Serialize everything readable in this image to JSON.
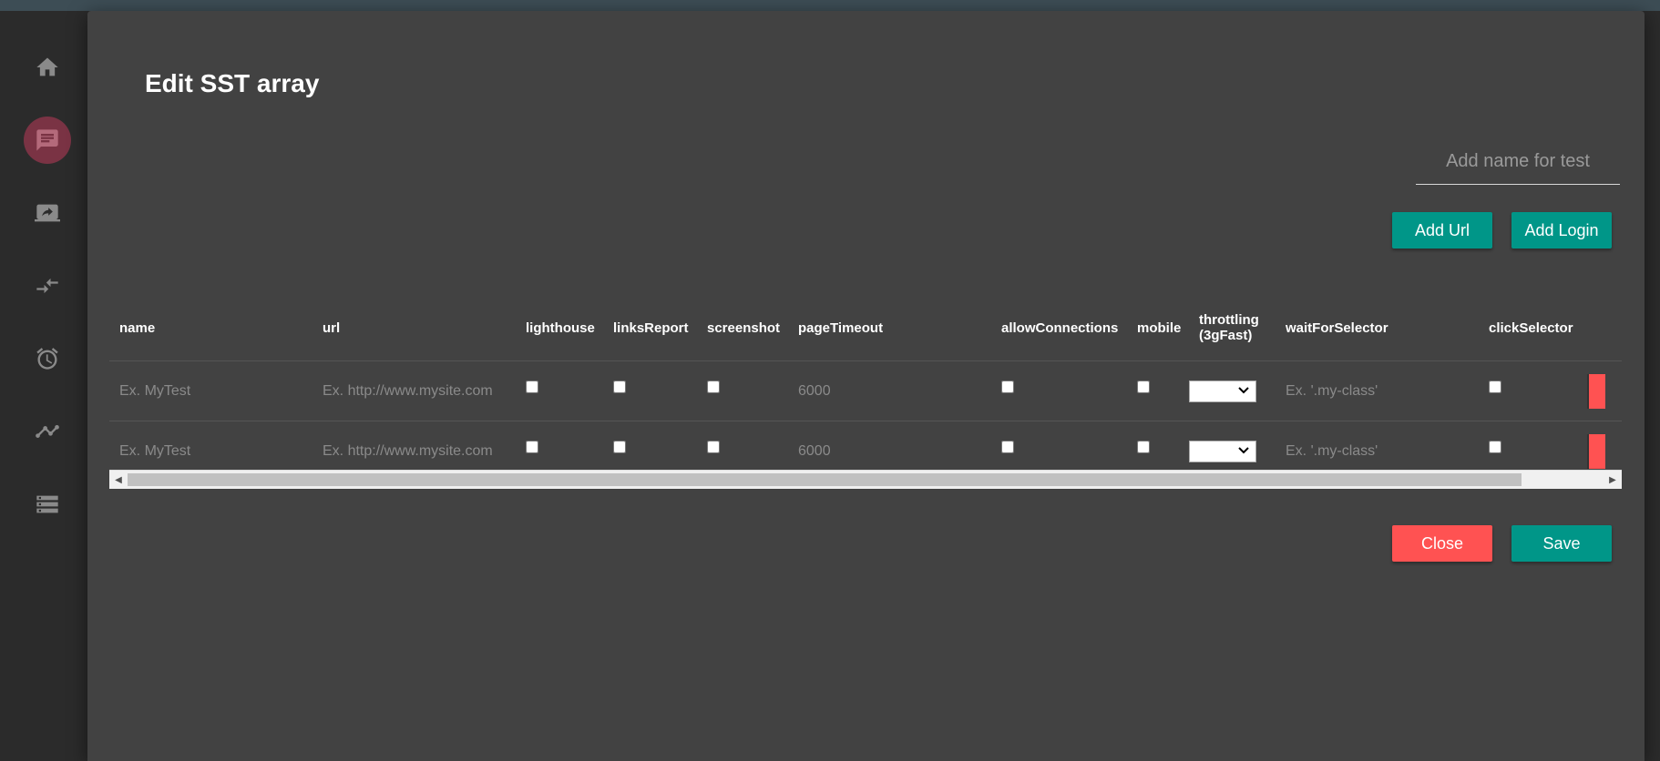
{
  "sidebar": {
    "icons": [
      "home-icon",
      "chat-icon",
      "laptop-share-icon",
      "compare-arrows-icon",
      "alarm-icon",
      "trending-icon",
      "storage-icon"
    ]
  },
  "modal": {
    "title": "Edit SST array",
    "name_placeholder": "Add name for test",
    "add_url_label": "Add Url",
    "add_login_label": "Add Login",
    "close_label": "Close",
    "save_label": "Save"
  },
  "table": {
    "headers": {
      "name": "name",
      "url": "url",
      "lighthouse": "lighthouse",
      "linksReport": "linksReport",
      "screenshot": "screenshot",
      "pageTimeout": "pageTimeout",
      "allowConnections": "allowConnections",
      "mobile": "mobile",
      "throttling_line1": "throttling",
      "throttling_line2": "(3gFast)",
      "waitForSelector": "waitForSelector",
      "clickSelector": "clickSelector"
    },
    "rows": [
      {
        "name_placeholder": "Ex. MyTest",
        "url_placeholder": "Ex. http://www.mysite.com",
        "pageTimeout_placeholder": "6000",
        "waitForSelector_placeholder": "Ex. '.my-class'"
      },
      {
        "name_placeholder": "Ex. MyTest",
        "url_placeholder": "Ex. http://www.mysite.com",
        "pageTimeout_placeholder": "6000",
        "waitForSelector_placeholder": "Ex. '.my-class'"
      }
    ]
  },
  "colors": {
    "modal_bg": "#424242",
    "teal": "#009688",
    "red": "#ff5252",
    "active_sidebar": "#7a3344"
  }
}
